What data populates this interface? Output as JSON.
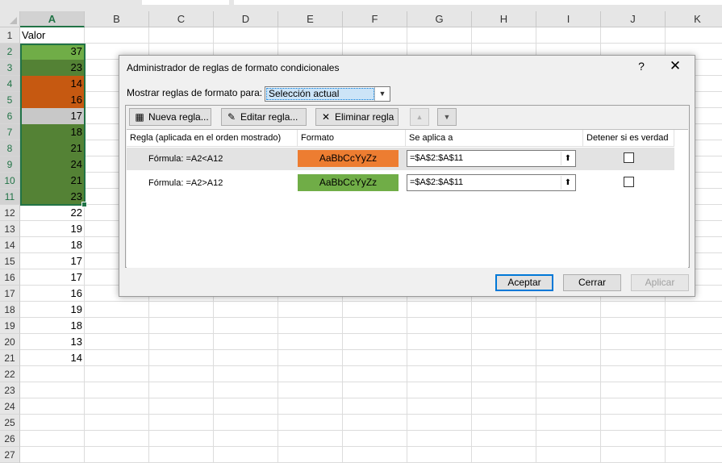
{
  "sheet": {
    "columns": [
      "A",
      "B",
      "C",
      "D",
      "E",
      "F",
      "G",
      "H",
      "I",
      "J",
      "K"
    ],
    "rows": [
      {
        "n": "1",
        "a": "Valor",
        "type": "text"
      },
      {
        "n": "2",
        "a": "37",
        "type": "num",
        "fill": "#70ad47"
      },
      {
        "n": "3",
        "a": "23",
        "type": "num",
        "fill": "#548235"
      },
      {
        "n": "4",
        "a": "14",
        "type": "num",
        "fill": "#c65911"
      },
      {
        "n": "5",
        "a": "16",
        "type": "num",
        "fill": "#c65911"
      },
      {
        "n": "6",
        "a": "17",
        "type": "num",
        "fill": "#c8c8c8"
      },
      {
        "n": "7",
        "a": "18",
        "type": "num",
        "fill": "#548235"
      },
      {
        "n": "8",
        "a": "21",
        "type": "num",
        "fill": "#548235"
      },
      {
        "n": "9",
        "a": "24",
        "type": "num",
        "fill": "#548235"
      },
      {
        "n": "10",
        "a": "21",
        "type": "num",
        "fill": "#548235"
      },
      {
        "n": "11",
        "a": "23",
        "type": "num",
        "fill": "#548235"
      },
      {
        "n": "12",
        "a": "22",
        "type": "num"
      },
      {
        "n": "13",
        "a": "19",
        "type": "num"
      },
      {
        "n": "14",
        "a": "18",
        "type": "num"
      },
      {
        "n": "15",
        "a": "17",
        "type": "num"
      },
      {
        "n": "16",
        "a": "17",
        "type": "num"
      },
      {
        "n": "17",
        "a": "16",
        "type": "num"
      },
      {
        "n": "18",
        "a": "19",
        "type": "num"
      },
      {
        "n": "19",
        "a": "18",
        "type": "num"
      },
      {
        "n": "20",
        "a": "13",
        "type": "num"
      },
      {
        "n": "21",
        "a": "14",
        "type": "num"
      },
      {
        "n": "22",
        "a": "",
        "type": "num"
      },
      {
        "n": "23",
        "a": "",
        "type": "num"
      },
      {
        "n": "24",
        "a": "",
        "type": "num"
      },
      {
        "n": "25",
        "a": "",
        "type": "num"
      },
      {
        "n": "26",
        "a": "",
        "type": "num"
      },
      {
        "n": "27",
        "a": "",
        "type": "num"
      }
    ]
  },
  "dialog": {
    "title": "Administrador de reglas de formato condicionales",
    "help": "?",
    "close": "✕",
    "show_rules_label": "Mostrar reglas de formato para:",
    "show_rules_value": "Selección actual",
    "dropdown_arrow": "▼",
    "toolbar": {
      "new_rule": "Nueva regla...",
      "edit_rule": "Editar regla...",
      "delete_rule": "Eliminar regla",
      "move_up": "▲",
      "move_down": "▼",
      "new_icon": "▦",
      "edit_icon": "✎",
      "delete_icon": "✕"
    },
    "headers": {
      "rule": "Regla (aplicada en el orden mostrado)",
      "format": "Formato",
      "applies_to": "Se aplica a",
      "stop_if_true": "Detener si es verdad"
    },
    "rules": [
      {
        "formula": "Fórmula: =A2<A12",
        "preview": "AaBbCcYyZz",
        "preview_color": "#ed7d31",
        "applies_to": "=$A$2:$A$11",
        "collapse_icon": "⬆",
        "selected": true
      },
      {
        "formula": "Fórmula: =A2>A12",
        "preview": "AaBbCcYyZz",
        "preview_color": "#70ad47",
        "applies_to": "=$A$2:$A$11",
        "collapse_icon": "⬆",
        "selected": false
      }
    ],
    "buttons": {
      "ok": "Aceptar",
      "close": "Cerrar",
      "apply": "Aplicar"
    }
  }
}
